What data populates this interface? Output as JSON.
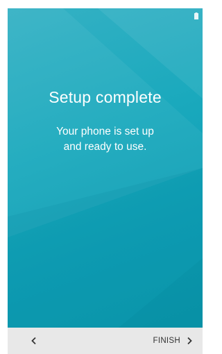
{
  "screen": {
    "title": "Setup complete",
    "message": "Your phone is set up and ready to use."
  },
  "status_bar": {
    "icon": "battery-icon"
  },
  "nav": {
    "back_icon": "chevron-left-icon",
    "finish_label": "FINISH",
    "finish_icon": "chevron-right-icon"
  },
  "colors": {
    "background_teal": "#1aa9bd",
    "light_teal": "#35b1c4",
    "nav_bar": "#e8e8e8",
    "text_light": "#ffffff",
    "text_dark": "#333333"
  }
}
